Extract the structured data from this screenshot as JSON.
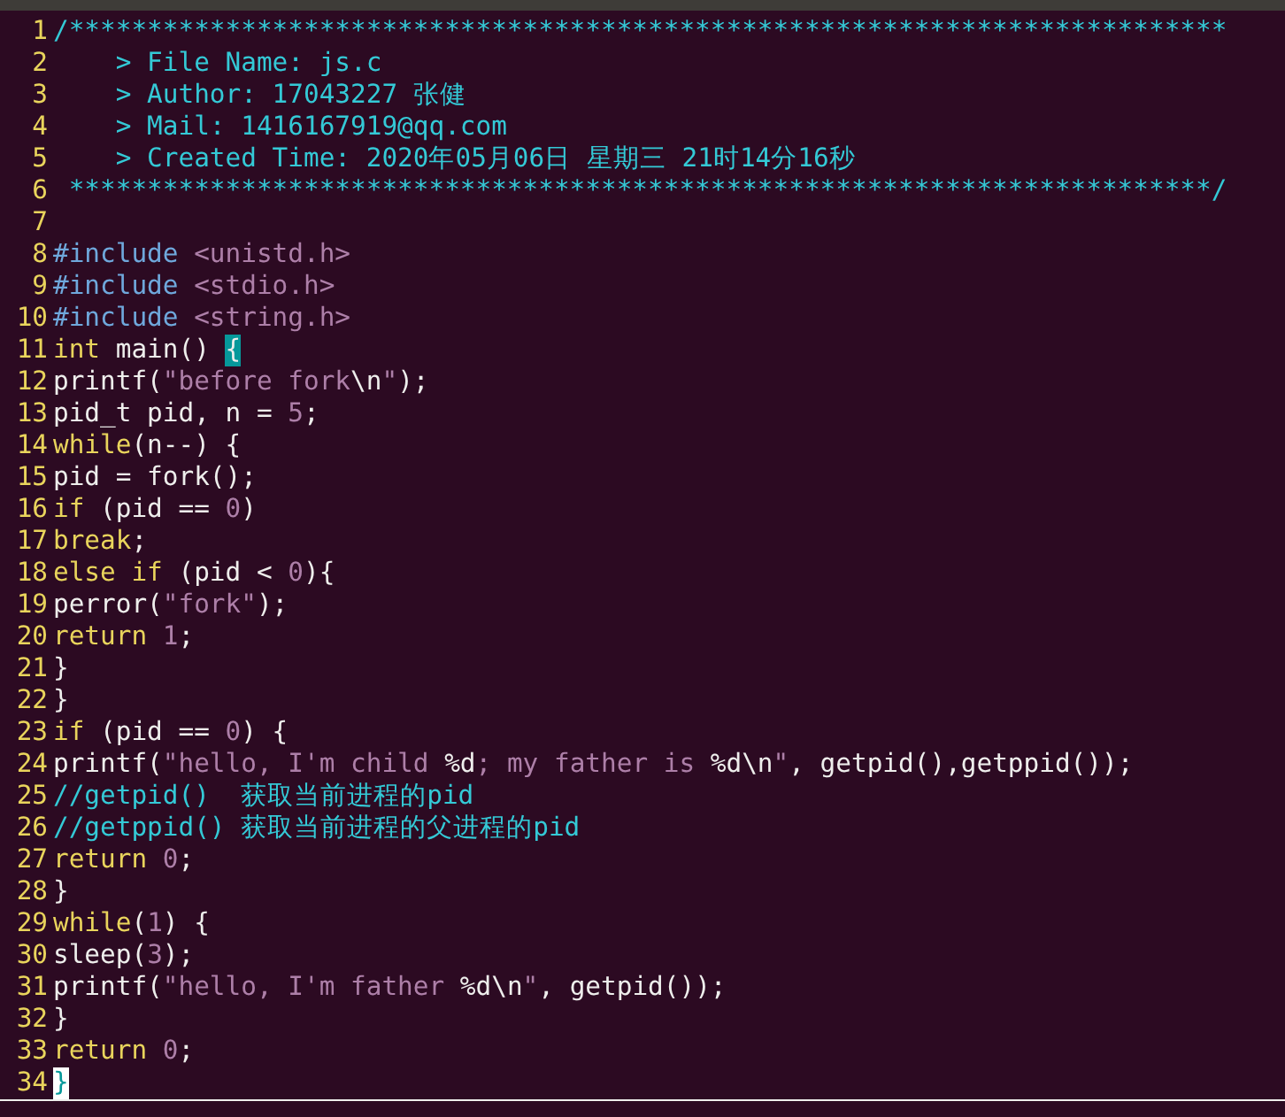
{
  "lines": [
    {
      "number": "1",
      "current": false,
      "segments": [
        {
          "kind": "comment",
          "text": "/**************************************************************************"
        }
      ]
    },
    {
      "number": "2",
      "current": false,
      "segments": [
        {
          "kind": "comment",
          "text": "    > File Name: js.c"
        }
      ]
    },
    {
      "number": "3",
      "current": false,
      "segments": [
        {
          "kind": "comment",
          "text": "    > Author: 17043227 张健"
        }
      ]
    },
    {
      "number": "4",
      "current": false,
      "segments": [
        {
          "kind": "comment",
          "text": "    > Mail: 1416167919@qq.com"
        }
      ]
    },
    {
      "number": "5",
      "current": false,
      "segments": [
        {
          "kind": "comment",
          "text": "    > Created Time: 2020年05月06日 星期三 21时14分16秒"
        }
      ]
    },
    {
      "number": "6",
      "current": false,
      "segments": [
        {
          "kind": "comment",
          "text": " *************************************************************************/"
        }
      ]
    },
    {
      "number": "7",
      "current": false
    },
    {
      "number": "8",
      "current": false,
      "segments": [
        {
          "kind": "preproc",
          "text": "#include "
        },
        {
          "kind": "string",
          "text": "<unistd.h>"
        }
      ]
    },
    {
      "number": "9",
      "current": false,
      "segments": [
        {
          "kind": "preproc",
          "text": "#include "
        },
        {
          "kind": "string",
          "text": "<stdio.h>"
        }
      ]
    },
    {
      "number": "10",
      "current": false,
      "segments": [
        {
          "kind": "preproc",
          "text": "#include "
        },
        {
          "kind": "string",
          "text": "<string.h>"
        }
      ]
    },
    {
      "number": "11",
      "current": false,
      "segments": [
        {
          "kind": "keyword",
          "text": "int"
        },
        {
          "kind": "normal",
          "text": " main() "
        },
        {
          "kind": "match",
          "text": "{"
        }
      ]
    },
    {
      "number": "12",
      "current": false,
      "segments": [
        {
          "kind": "normal",
          "text": "printf("
        },
        {
          "kind": "string",
          "text": "\"before fork"
        },
        {
          "kind": "normal",
          "text": "\\n"
        },
        {
          "kind": "string",
          "text": "\""
        },
        {
          "kind": "normal",
          "text": ");"
        }
      ]
    },
    {
      "number": "13",
      "current": false,
      "segments": [
        {
          "kind": "normal",
          "text": "pid_t pid, n = "
        },
        {
          "kind": "string",
          "text": "5"
        },
        {
          "kind": "normal",
          "text": ";"
        }
      ]
    },
    {
      "number": "14",
      "current": false,
      "segments": [
        {
          "kind": "keyword",
          "text": "while"
        },
        {
          "kind": "normal",
          "text": "(n--) {"
        }
      ]
    },
    {
      "number": "15",
      "current": false,
      "segments": [
        {
          "kind": "normal",
          "text": "pid = fork();"
        }
      ]
    },
    {
      "number": "16",
      "current": false,
      "segments": [
        {
          "kind": "keyword",
          "text": "if"
        },
        {
          "kind": "normal",
          "text": " (pid == "
        },
        {
          "kind": "string",
          "text": "0"
        },
        {
          "kind": "normal",
          "text": ")"
        }
      ]
    },
    {
      "number": "17",
      "current": false,
      "segments": [
        {
          "kind": "keyword",
          "text": "break"
        },
        {
          "kind": "normal",
          "text": ";"
        }
      ]
    },
    {
      "number": "18",
      "current": false,
      "segments": [
        {
          "kind": "keyword",
          "text": "else if"
        },
        {
          "kind": "normal",
          "text": " (pid < "
        },
        {
          "kind": "string",
          "text": "0"
        },
        {
          "kind": "normal",
          "text": "){"
        }
      ]
    },
    {
      "number": "19",
      "current": false,
      "segments": [
        {
          "kind": "normal",
          "text": "perror("
        },
        {
          "kind": "string",
          "text": "\"fork\""
        },
        {
          "kind": "normal",
          "text": ");"
        }
      ]
    },
    {
      "number": "20",
      "current": false,
      "segments": [
        {
          "kind": "keyword",
          "text": "return "
        },
        {
          "kind": "string",
          "text": "1"
        },
        {
          "kind": "normal",
          "text": ";"
        }
      ]
    },
    {
      "number": "21",
      "current": false,
      "segments": [
        {
          "kind": "normal",
          "text": "}"
        }
      ]
    },
    {
      "number": "22",
      "current": false,
      "segments": [
        {
          "kind": "normal",
          "text": "}"
        }
      ]
    },
    {
      "number": "23",
      "current": false,
      "segments": [
        {
          "kind": "keyword",
          "text": "if"
        },
        {
          "kind": "normal",
          "text": " (pid == "
        },
        {
          "kind": "string",
          "text": "0"
        },
        {
          "kind": "normal",
          "text": ") {"
        }
      ]
    },
    {
      "number": "24",
      "current": false,
      "segments": [
        {
          "kind": "normal",
          "text": "printf("
        },
        {
          "kind": "string",
          "text": "\"hello, I'm child "
        },
        {
          "kind": "normal",
          "text": "%d"
        },
        {
          "kind": "string",
          "text": "; my father is "
        },
        {
          "kind": "normal",
          "text": "%d\\n"
        },
        {
          "kind": "string",
          "text": "\""
        },
        {
          "kind": "normal",
          "text": ", getpid(),getppid());"
        }
      ]
    },
    {
      "number": "25",
      "current": false,
      "segments": [
        {
          "kind": "comment",
          "text": "//getpid()  获取当前进程的pid"
        }
      ]
    },
    {
      "number": "26",
      "current": false,
      "segments": [
        {
          "kind": "comment",
          "text": "//getppid() 获取当前进程的父进程的pid"
        }
      ]
    },
    {
      "number": "27",
      "current": false,
      "segments": [
        {
          "kind": "keyword",
          "text": "return "
        },
        {
          "kind": "string",
          "text": "0"
        },
        {
          "kind": "normal",
          "text": ";"
        }
      ]
    },
    {
      "number": "28",
      "current": false,
      "segments": [
        {
          "kind": "normal",
          "text": "}"
        }
      ]
    },
    {
      "number": "29",
      "current": false,
      "segments": [
        {
          "kind": "keyword",
          "text": "while"
        },
        {
          "kind": "normal",
          "text": "("
        },
        {
          "kind": "string",
          "text": "1"
        },
        {
          "kind": "normal",
          "text": ") {"
        }
      ]
    },
    {
      "number": "30",
      "current": false,
      "segments": [
        {
          "kind": "normal",
          "text": "sleep("
        },
        {
          "kind": "string",
          "text": "3"
        },
        {
          "kind": "normal",
          "text": ");"
        }
      ]
    },
    {
      "number": "31",
      "current": false,
      "segments": [
        {
          "kind": "normal",
          "text": "printf("
        },
        {
          "kind": "string",
          "text": "\"hello, I'm father "
        },
        {
          "kind": "normal",
          "text": "%d\\n"
        },
        {
          "kind": "string",
          "text": "\""
        },
        {
          "kind": "normal",
          "text": ", getpid());"
        }
      ]
    },
    {
      "number": "32",
      "current": false,
      "segments": [
        {
          "kind": "normal",
          "text": "}"
        }
      ]
    },
    {
      "number": "33",
      "current": false,
      "segments": [
        {
          "kind": "keyword",
          "text": "return "
        },
        {
          "kind": "string",
          "text": "0"
        },
        {
          "kind": "normal",
          "text": ";"
        }
      ]
    },
    {
      "number": "34",
      "current": true,
      "segments": [
        {
          "kind": "cursor",
          "text": "}"
        }
      ]
    }
  ]
}
